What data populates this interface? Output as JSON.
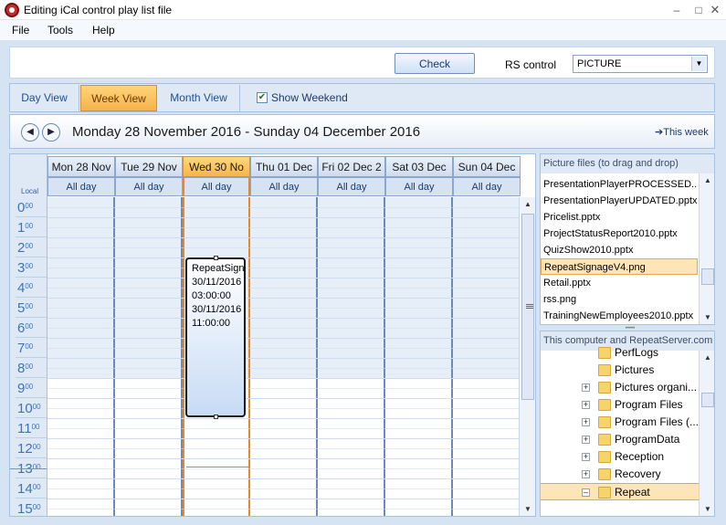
{
  "window": {
    "title": "Editing iCal control play list file",
    "minimize": "–",
    "maximize": "□",
    "close": "✕"
  },
  "menu": {
    "file": "File",
    "tools": "Tools",
    "help": "Help"
  },
  "toolbar": {
    "check_label": "Check",
    "rs_control_label": "RS control",
    "rs_control_value": "PICTURE"
  },
  "views": {
    "day": "Day View",
    "week": "Week View",
    "month": "Month View",
    "show_weekend": "Show Weekend",
    "show_weekend_checked": true,
    "active": "week"
  },
  "date_nav": {
    "range": "Monday 28 November 2016 - Sunday 04 December 2016",
    "this_week": "This week"
  },
  "calendar": {
    "local_label": "Local",
    "days": [
      "Mon 28 Nov",
      "Tue 29 Nov",
      "Wed 30 No",
      "Thu 01 Dec",
      "Fri 02 Dec 2",
      "Sat 03 Dec",
      "Sun 04 Dec"
    ],
    "all_day_label": "All day",
    "today_index": 2,
    "hours": [
      {
        "h": "0",
        "m": "00"
      },
      {
        "h": "1",
        "m": "00"
      },
      {
        "h": "2",
        "m": "00"
      },
      {
        "h": "3",
        "m": "00"
      },
      {
        "h": "4",
        "m": "00"
      },
      {
        "h": "5",
        "m": "00"
      },
      {
        "h": "6",
        "m": "00"
      },
      {
        "h": "7",
        "m": "00"
      },
      {
        "h": "8",
        "m": "00"
      },
      {
        "h": "9",
        "m": "00"
      },
      {
        "h": "10",
        "m": "00"
      },
      {
        "h": "11",
        "m": "00"
      },
      {
        "h": "12",
        "m": "00"
      },
      {
        "h": "13",
        "m": "00"
      },
      {
        "h": "14",
        "m": "00"
      },
      {
        "h": "15",
        "m": "00"
      }
    ],
    "appointment": {
      "lines": [
        "RepeatSign",
        "30/11/2016",
        "03:00:00",
        "30/11/2016",
        "11:00:00"
      ]
    }
  },
  "files_panel": {
    "header": "Picture files (to drag and drop)",
    "items": [
      "PresentationPlayerPROCESSED....",
      "PresentationPlayerUPDATED.pptx",
      "Pricelist.pptx",
      "ProjectStatusReport2010.pptx",
      "QuizShow2010.pptx",
      "RepeatSignageV4.png",
      "Retail.pptx",
      "rss.png",
      "TrainingNewEmployees2010.pptx"
    ],
    "selected_index": 5
  },
  "tree_panel": {
    "header": "This computer and RepeatServer.com",
    "items": [
      {
        "label": "PerfLogs",
        "expandable": false
      },
      {
        "label": "Pictures",
        "expandable": false
      },
      {
        "label": "Pictures organi...",
        "expandable": true,
        "sign": "+"
      },
      {
        "label": "Program Files",
        "expandable": true,
        "sign": "+"
      },
      {
        "label": "Program Files (...",
        "expandable": true,
        "sign": "+"
      },
      {
        "label": "ProgramData",
        "expandable": true,
        "sign": "+"
      },
      {
        "label": "Reception",
        "expandable": true,
        "sign": "+"
      },
      {
        "label": "Recovery",
        "expandable": true,
        "sign": "+"
      },
      {
        "label": "Repeat",
        "expandable": true,
        "sign": "–"
      }
    ],
    "selected_index": 8
  }
}
